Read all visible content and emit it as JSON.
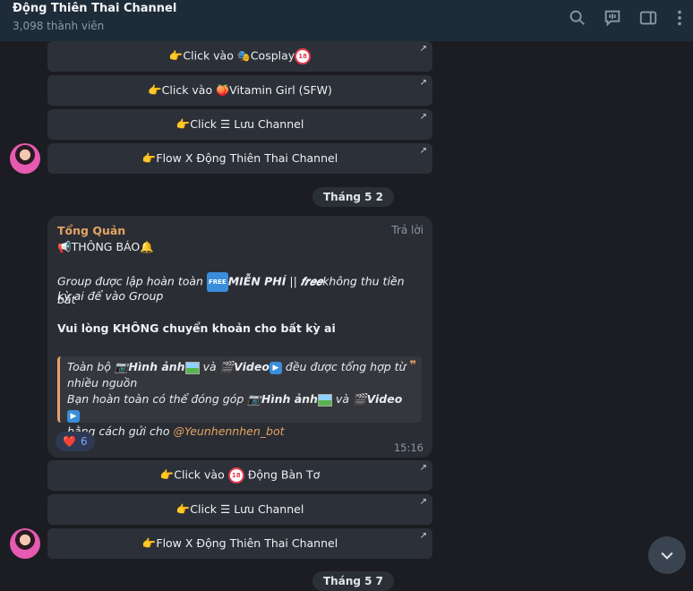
{
  "header": {
    "title": "Động Thiên Thai Channel",
    "subtitle": "3,098 thành viên",
    "icons": [
      "search-icon",
      "live-chat-icon",
      "sidebar-toggle-icon",
      "more-icon"
    ]
  },
  "buttons_top": [
    {
      "text": "Click vào",
      "emoji": "🎭",
      "tail": "Cosplay",
      "badge": "18"
    },
    {
      "text": "Click vào",
      "emoji": "🍑",
      "tail": "Vitamin Girl (SFW)"
    },
    {
      "text": "Click ☰ Lưu Channel"
    },
    {
      "text": "Flow X Động Thiên Thai Channel"
    }
  ],
  "date_pill_1": "Tháng 5 2",
  "message": {
    "author": "Tổng Quản",
    "reply_label": "Trả lời",
    "announce": "THÔNG BÁO",
    "line1a": "Group được lập hoàn toàn",
    "free_icon": "FREE",
    "line1b": "MIỄN PHÍ",
    "line1c": "||",
    "line1d": "𝒇𝒓𝒆𝒆",
    "line1e": "không thu tiền bất",
    "line2": "kỳ ai để vào Group",
    "line3": "Vui lòng KHÔNG chuyển khoản cho bất kỳ ai",
    "quote": {
      "q1a": "Toàn bộ",
      "q1b": "Hình ảnh",
      "q1c": "và",
      "q1d": "Video",
      "q1e": "đều được tổng hợp từ",
      "q2": "nhiều nguồn",
      "q3a": "Bạn hoàn toàn có thể đóng góp",
      "q3b": "Hình ảnh",
      "q3c": "và",
      "q3d": "Video",
      "q4a": "bằng cách gửi cho",
      "q4b": "@Yeunhennhen_bot"
    },
    "reaction_emoji": "❤️",
    "reaction_count": "6",
    "time": "15:16"
  },
  "buttons_bottom": [
    {
      "text": "Click vào",
      "badge": "18",
      "tail": "Động Bàn Tơ"
    },
    {
      "text": "Click ☰ Lưu Channel"
    },
    {
      "text": "Flow X Động Thiên Thai Channel"
    }
  ],
  "date_pill_2": "Tháng 5 7",
  "colors": {
    "accent": "#e4a463",
    "header_bg": "#1e2c3a",
    "chat_bg": "#1b1d22",
    "button_bg": "#2c3038"
  }
}
